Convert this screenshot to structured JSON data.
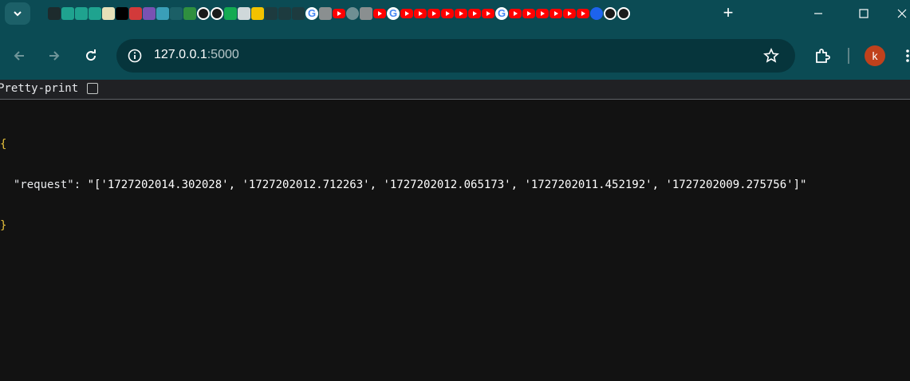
{
  "browser": {
    "tab_favicons": [
      "app-icon",
      "feather-icon",
      "feather-icon",
      "feather-icon",
      "chart-icon",
      "medium-icon",
      "bookmark-icon",
      "bootstrap-icon",
      "wave-icon",
      "link-icon",
      "code-icon",
      "openai-icon",
      "openai-icon",
      "mongodb-icon",
      "grid-icon",
      "badge-icon",
      "chevron-icon",
      "chevron-icon",
      "chevron-icon",
      "google-icon",
      "video-icon",
      "youtube-icon",
      "globe-icon",
      "video-icon",
      "youtube-icon",
      "google-icon",
      "youtube-icon",
      "youtube-icon",
      "youtube-icon",
      "youtube-icon",
      "youtube-icon",
      "youtube-icon",
      "youtube-icon",
      "google-icon",
      "youtube-icon",
      "youtube-icon",
      "youtube-icon",
      "youtube-icon",
      "youtube-icon",
      "youtube-icon",
      "docker-icon",
      "openai-icon",
      "openai-icon"
    ],
    "new_tab_label": "+",
    "address": {
      "host": "127.0.0.1",
      "port": ":5000"
    },
    "profile_initial": "k"
  },
  "viewer": {
    "pretty_print_label": "Pretty-print",
    "pretty_print_checked": false
  },
  "json_body": {
    "open_brace": "{",
    "key": "\"request\"",
    "colon": ": ",
    "value": "\"['1727202014.302028', '1727202012.712263', '1727202012.065173', '1727202011.452192', '1727202009.275756']\"",
    "close_brace": "}"
  },
  "colors": {
    "chrome_bg": "#0b4b54",
    "omnibox_bg": "#06353c",
    "page_bg": "#121212",
    "avatar_bg": "#c0411c"
  }
}
